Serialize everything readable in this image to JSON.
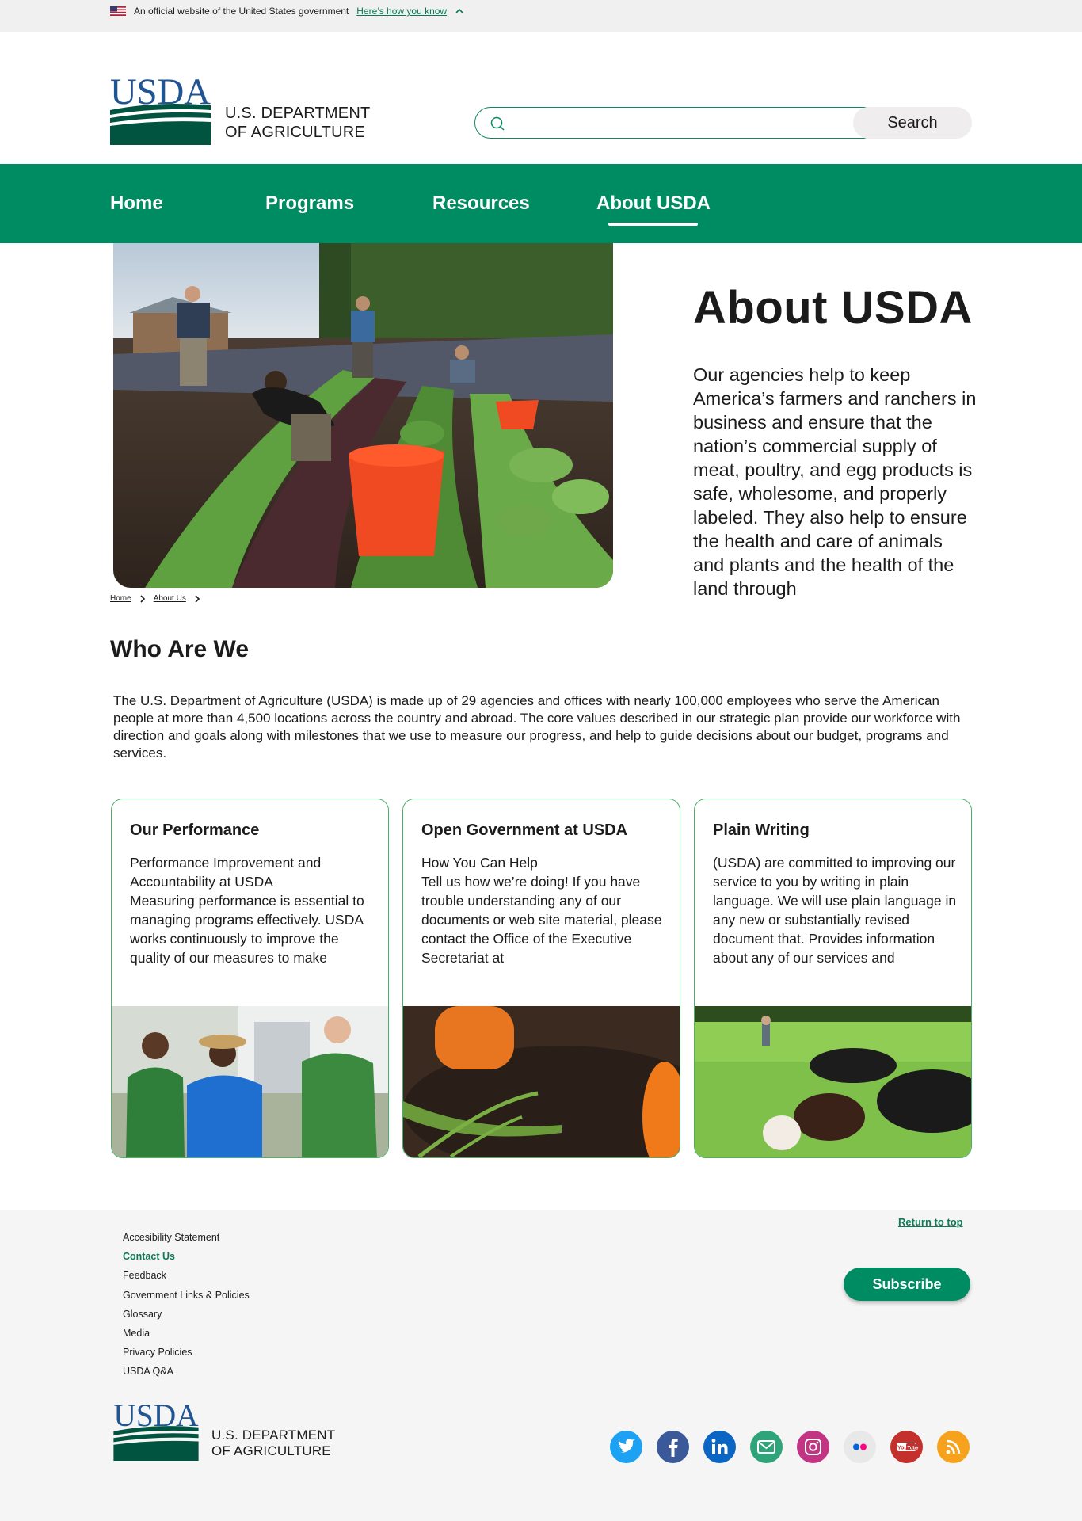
{
  "banner": {
    "text": "An official website of the United States government",
    "link": "Here’s how you know"
  },
  "header": {
    "logo_wordmark": "USDA",
    "logo_line1": "U.S. DEPARTMENT",
    "logo_line2": "OF AGRICULTURE",
    "search_value": "",
    "search_button": "Search"
  },
  "nav": {
    "items": [
      "Home",
      "Programs",
      "Resources",
      "About USDA"
    ],
    "active": "About USDA"
  },
  "hero": {
    "title": "About USDA",
    "text": "Our agencies help to keep America’s farmers and ranchers in business and ensure that the nation’s commercial supply of meat, poultry, and egg products is safe, wholesome, and properly labeled. They also help to ensure the health and care of animals and plants and the health of the land through"
  },
  "breadcrumb": {
    "items": [
      "Home",
      "About Us"
    ]
  },
  "who": {
    "title": "Who Are We",
    "text": "The U.S. Department of Agriculture (USDA) is made up of 29 agencies and offices with nearly 100,000 employees who serve the American people at more than 4,500 locations across the country and abroad. The core values described in our strategic plan provide our workforce with direction and goals along with milestones that we use to measure our progress, and help to guide decisions about our budget, programs and services."
  },
  "cards": [
    {
      "title": "Our Performance",
      "text": "Performance Improvement and Accountability at USDA\nMeasuring performance is essential to managing programs effectively. USDA works continuously to improve the quality of our measures to make"
    },
    {
      "title": "Open Government at USDA",
      "text": "How You Can Help\nTell us how we’re doing! If you have trouble understanding any of our documents or web site material, please contact the Office of the Executive Secretariat at"
    },
    {
      "title": "Plain Writing",
      "text": "(USDA) are committed to improving our service to you by writing in plain language. We will use plain language in any new or substantially revised document that. Provides information about any of our services and"
    }
  ],
  "footer": {
    "links": [
      "Accesibility Statement",
      "Contact Us",
      "Feedback",
      "Government Links & Policies",
      "Glossary",
      "Media",
      "Privacy Policies",
      "USDA Q&A"
    ],
    "return_top": "Return to top",
    "subscribe": "Subscribe",
    "logo_wordmark": "USDA",
    "logo_line1": "U.S. DEPARTMENT",
    "logo_line2": "OF AGRICULTURE",
    "social": [
      {
        "name": "twitter-icon",
        "color": "#1da1f2"
      },
      {
        "name": "facebook-icon",
        "color": "#3b5998"
      },
      {
        "name": "linkedin-icon",
        "color": "#0a66c2"
      },
      {
        "name": "email-icon",
        "color": "#2fa37a"
      },
      {
        "name": "instagram-icon",
        "color": "#c13584"
      },
      {
        "name": "flickr-icon",
        "color": "#e8e8e8"
      },
      {
        "name": "youtube-icon",
        "color": "#c4302b"
      },
      {
        "name": "rss-icon",
        "color": "#f7a21c"
      }
    ]
  },
  "colors": {
    "brand_green": "#008c62",
    "usda_blue": "#205493",
    "usda_dark_green": "#005440"
  }
}
